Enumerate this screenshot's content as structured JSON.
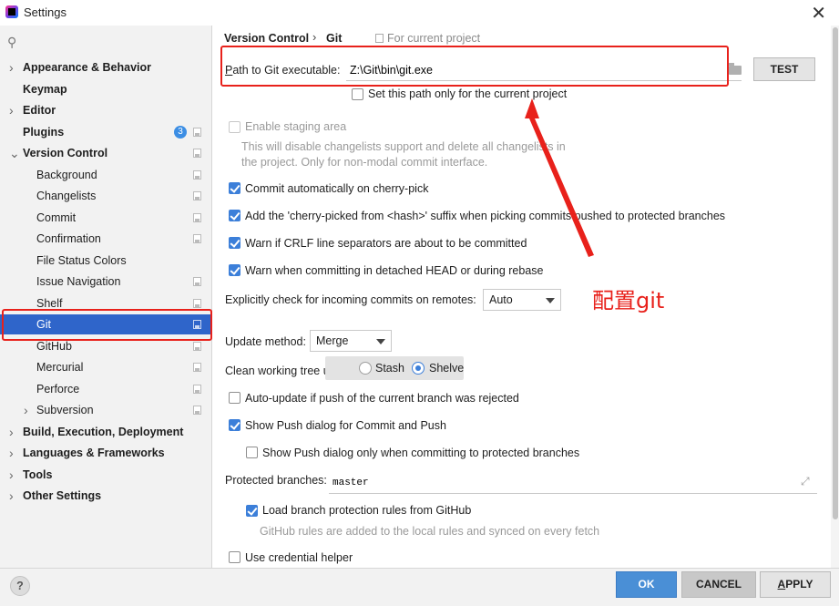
{
  "window": {
    "title": "Settings"
  },
  "search": {
    "placeholder": ""
  },
  "sidebar": {
    "items": [
      {
        "label": "Appearance & Behavior",
        "level": 0,
        "expand": "collapsed",
        "bold": true
      },
      {
        "label": "Keymap",
        "level": 0,
        "expand": "none",
        "bold": true
      },
      {
        "label": "Editor",
        "level": 0,
        "expand": "collapsed",
        "bold": true
      },
      {
        "label": "Plugins",
        "level": 0,
        "expand": "none",
        "bold": true,
        "badge": "3",
        "project_icon": true
      },
      {
        "label": "Version Control",
        "level": 0,
        "expand": "expanded",
        "bold": true,
        "project_icon": true
      },
      {
        "label": "Background",
        "level": 1,
        "project_icon": true
      },
      {
        "label": "Changelists",
        "level": 1,
        "project_icon": true
      },
      {
        "label": "Commit",
        "level": 1,
        "project_icon": true
      },
      {
        "label": "Confirmation",
        "level": 1,
        "project_icon": true
      },
      {
        "label": "File Status Colors",
        "level": 1,
        "project_icon": false
      },
      {
        "label": "Issue Navigation",
        "level": 1,
        "project_icon": true
      },
      {
        "label": "Shelf",
        "level": 1,
        "project_icon": true
      },
      {
        "label": "Git",
        "level": 1,
        "project_icon": true,
        "selected": true
      },
      {
        "label": "GitHub",
        "level": 1,
        "project_icon": true
      },
      {
        "label": "Mercurial",
        "level": 1,
        "project_icon": true
      },
      {
        "label": "Perforce",
        "level": 1,
        "project_icon": true
      },
      {
        "label": "Subversion",
        "level": 1,
        "expand": "collapsed",
        "project_icon": true
      },
      {
        "label": "Build, Execution, Deployment",
        "level": 0,
        "expand": "collapsed",
        "bold": true
      },
      {
        "label": "Languages & Frameworks",
        "level": 0,
        "expand": "collapsed",
        "bold": true
      },
      {
        "label": "Tools",
        "level": 0,
        "expand": "collapsed",
        "bold": true
      },
      {
        "label": "Other Settings",
        "level": 0,
        "expand": "collapsed",
        "bold": true
      }
    ]
  },
  "breadcrumb": {
    "parent": "Version Control",
    "separator": "›",
    "current": "Git",
    "scope": "For current project"
  },
  "path": {
    "label_prefix": "P",
    "label_rest": "ath to Git executable:",
    "value": "Z:\\Git\\bin\\git.exe",
    "test_label": "TEST"
  },
  "options": {
    "current_project_only": {
      "label": "Set this path only for the current project",
      "checked": false
    },
    "staging_area": {
      "label": "Enable staging area",
      "checked": false,
      "enabled": false
    },
    "staging_note_1": "This will disable changelists support and delete all changelists in",
    "staging_note_2": "the project. Only for non-modal commit interface.",
    "commit_cherry_pick": {
      "label": "Commit automatically on cherry-pick",
      "checked": true
    },
    "cherry_picked_suffix": {
      "label": "Add the 'cherry-picked from <hash>' suffix when picking commits pushed to protected branches",
      "checked": true
    },
    "warn_crlf": {
      "label": "Warn if CRLF line separators are about to be committed",
      "checked": true
    },
    "warn_detached": {
      "label": "Warn when committing in detached HEAD or during rebase",
      "checked": true
    },
    "incoming_label": "Explicitly check for incoming commits on remotes:",
    "incoming_value": "Auto",
    "update_method_label": "Update method:",
    "update_method_value": "Merge",
    "clean_tree_label": "Clean working tree using:",
    "clean_stash": "Stash",
    "clean_shelve": "Shelve",
    "clean_selected": "Shelve",
    "auto_update": {
      "label": "Auto-update if push of the current branch was rejected",
      "checked": false
    },
    "show_push_dialog": {
      "label": "Show Push dialog for Commit and Push",
      "checked": true
    },
    "show_push_protected": {
      "label": "Show Push dialog only when committing to protected branches",
      "checked": false
    },
    "protected_label": "Protected branches:",
    "protected_value": "master",
    "load_rules": {
      "label": "Load branch protection rules from GitHub",
      "checked": true
    },
    "rules_note": "GitHub rules are added to the local rules and synced on every fetch",
    "credential_helper": {
      "label": "Use credential helper",
      "checked": false
    }
  },
  "annotation": {
    "text": "配置git",
    "color": "#e8211b"
  },
  "footer": {
    "help": "?",
    "ok": "OK",
    "cancel": "CANCEL",
    "apply_prefix": "A",
    "apply_rest": "PPLY"
  },
  "colors": {
    "selection": "#2f65ca",
    "accent": "#3c7fd9",
    "annotation": "#e8211b"
  }
}
